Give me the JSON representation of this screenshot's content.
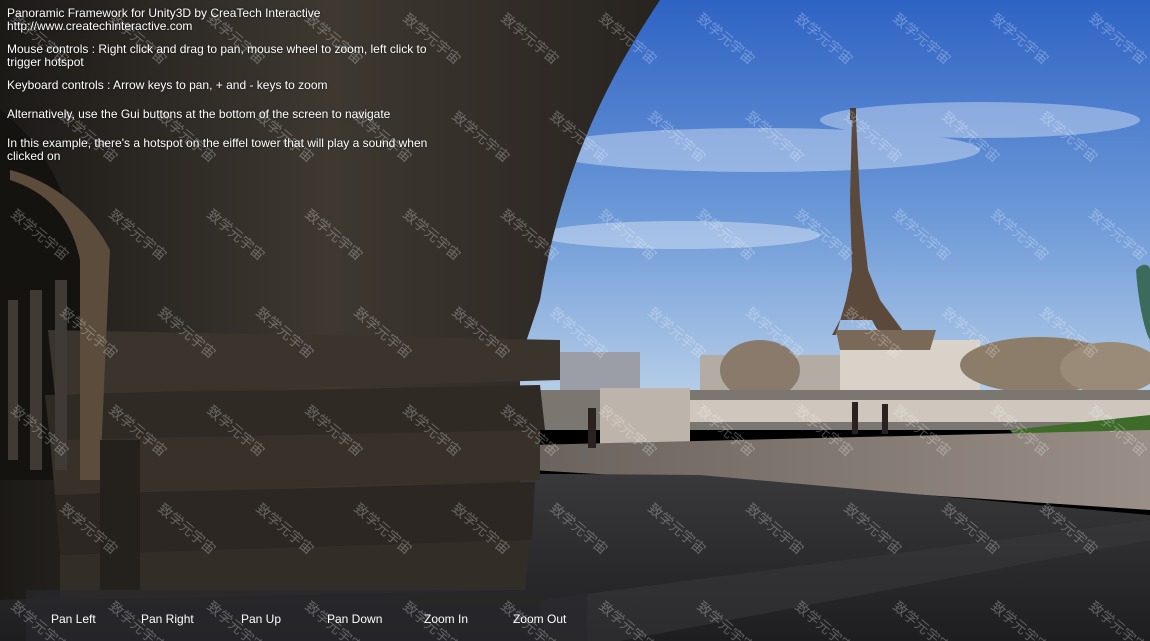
{
  "info": {
    "title": "Panoramic Framework for Unity3D by CreaTech Interactive",
    "url": "http://www.createchinteractive.com",
    "mouse_controls_1": "Mouse controls : Right click and drag to pan, mouse wheel to zoom, left click to",
    "mouse_controls_2": "trigger hotspot",
    "keyboard_controls": "Keyboard controls : Arrow keys to pan, + and - keys to zoom",
    "alternative": "Alternatively, use the Gui buttons at the bottom of the screen to navigate",
    "hotspot_1": "In this example, there's a hotspot on the eiffel tower that will play a sound when",
    "hotspot_2": "clicked on"
  },
  "toolbar": {
    "pan_left": "Pan Left",
    "pan_right": "Pan Right",
    "pan_up": "Pan Up",
    "pan_down": "Pan Down",
    "zoom_in": "Zoom In",
    "zoom_out": "Zoom Out"
  },
  "watermark": {
    "text": "致学元宇宙"
  },
  "colors": {
    "sky_top": "#2f63c4",
    "sky_bottom": "#a9c7e8",
    "stone_dark": "#2a2622",
    "stone_mid": "#4a443c",
    "road": "#2c2c2e",
    "toolbar_bg": "#28282c"
  }
}
